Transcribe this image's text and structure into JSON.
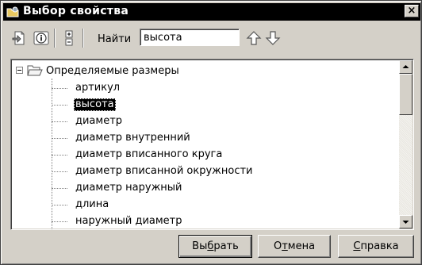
{
  "window": {
    "title": "Выбор свойства",
    "close_glyph": "×"
  },
  "toolbar": {
    "find_label": "Найти",
    "search_value": "высота",
    "icons": [
      "insert-property-icon",
      "info-icon",
      "expand-collapse-icon",
      "find-up-arrow-icon",
      "find-down-arrow-icon"
    ]
  },
  "tree": {
    "root_label": "Определяемые размеры",
    "root_expanded": true,
    "items": [
      {
        "label": "артикул",
        "selected": false
      },
      {
        "label": "высота",
        "selected": true
      },
      {
        "label": "диаметр",
        "selected": false
      },
      {
        "label": "диаметр внутренний",
        "selected": false
      },
      {
        "label": "диаметр вписанного круга",
        "selected": false
      },
      {
        "label": "диаметр вписанной окружности",
        "selected": false
      },
      {
        "label": "диаметр наружный",
        "selected": false
      },
      {
        "label": "длина",
        "selected": false
      },
      {
        "label": "наружный диаметр",
        "selected": false
      }
    ],
    "scroll_position": 0.0
  },
  "buttons": {
    "select": {
      "before": "Вы",
      "hotkey": "б",
      "after": "рать"
    },
    "cancel": {
      "before": "О",
      "hotkey": "т",
      "after": "мена"
    },
    "help": {
      "before": "",
      "hotkey": "С",
      "after": "правка"
    }
  },
  "colors": {
    "window_bg": "#d4d0c8",
    "titlebar_bg": "#000000",
    "selection_bg": "#000000"
  }
}
